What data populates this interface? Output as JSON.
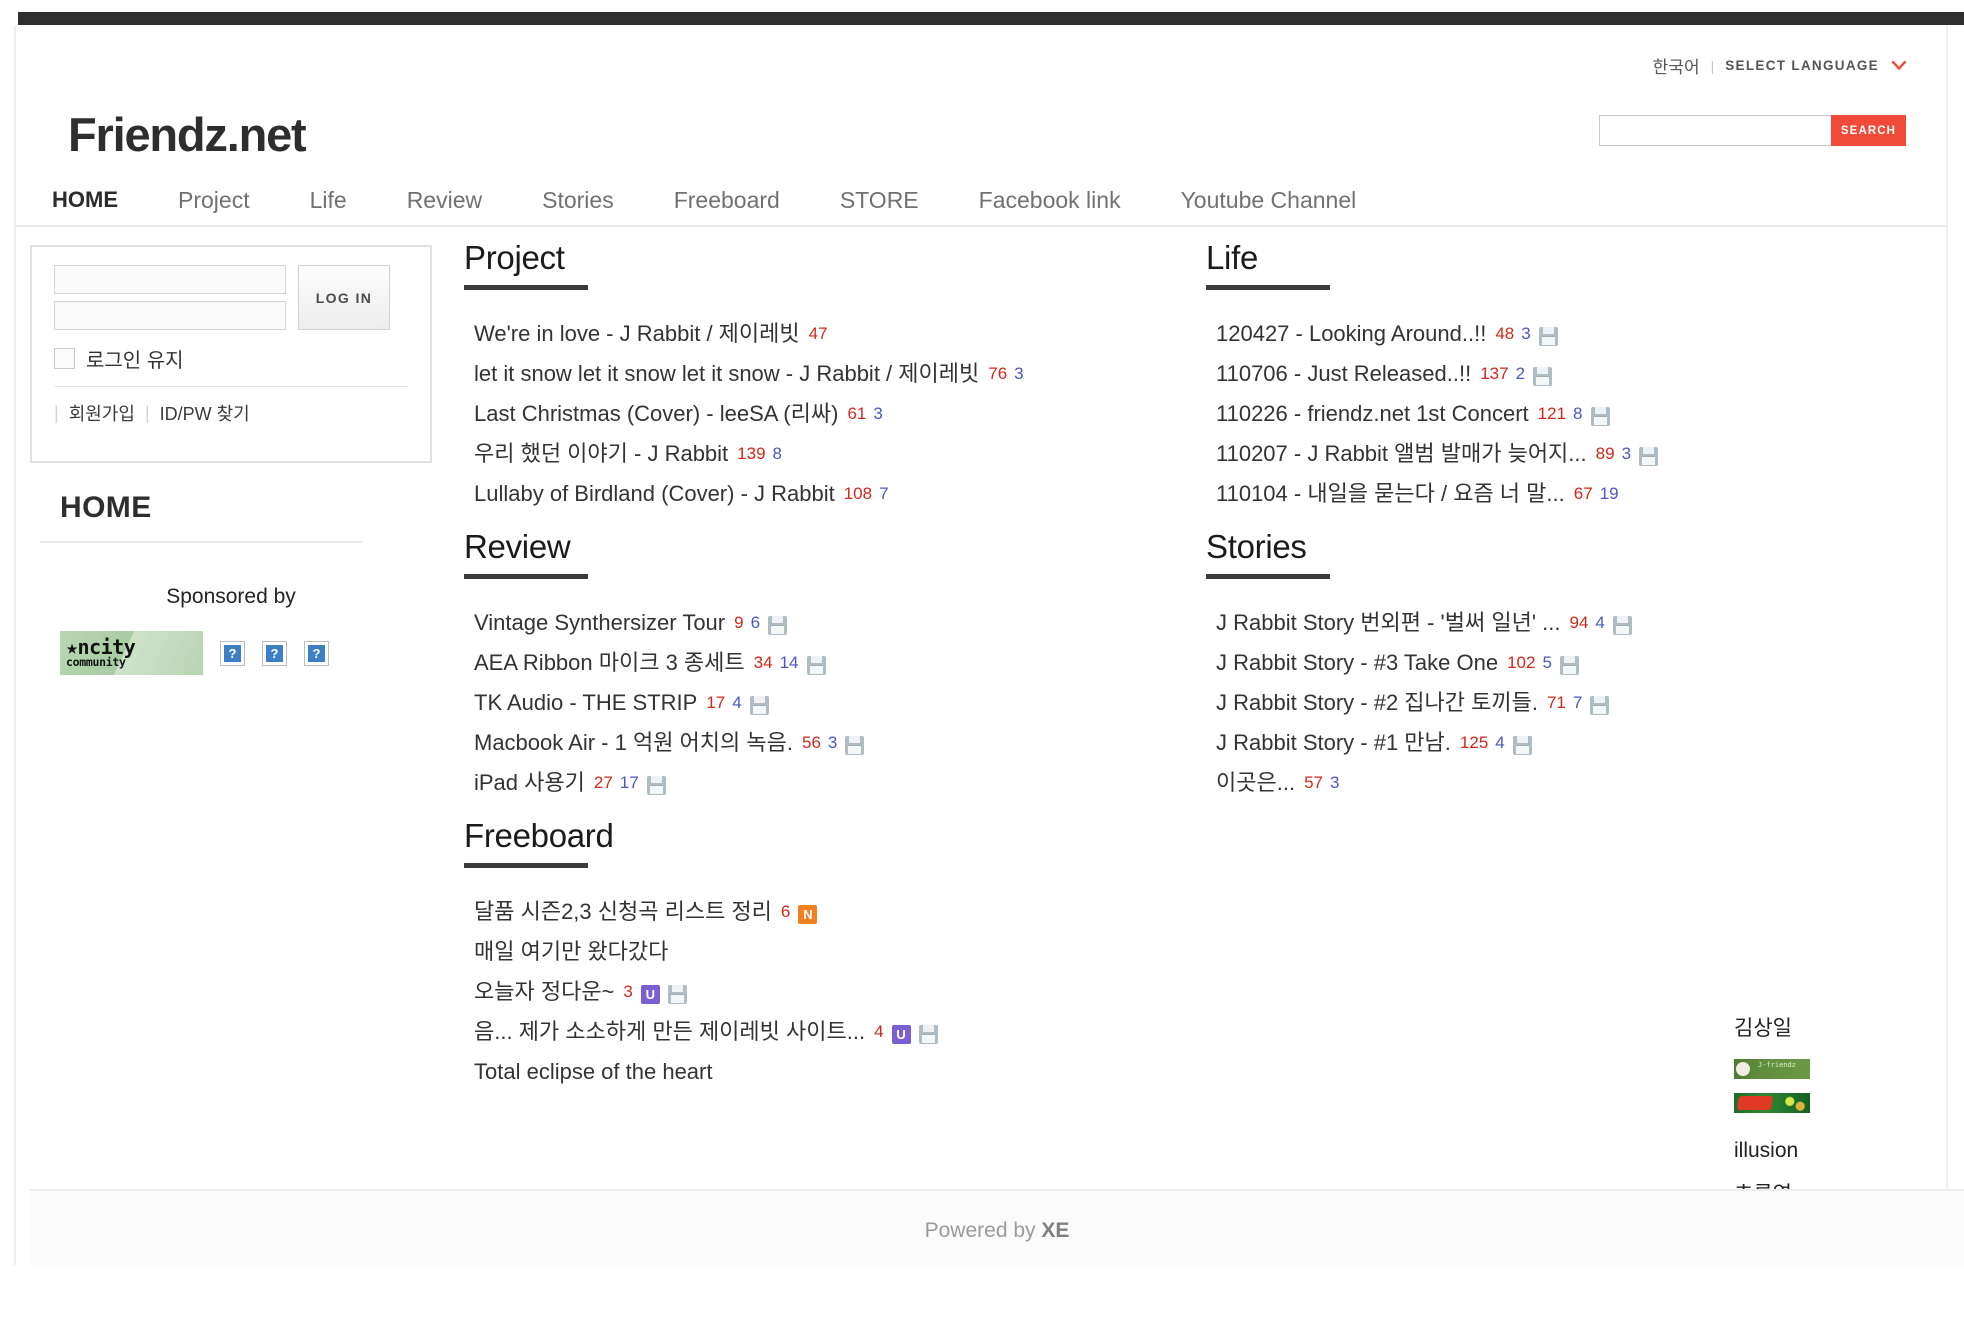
{
  "site": {
    "logo": "Friendz.net"
  },
  "topbar": {
    "current_language": "한국어",
    "separator": "|",
    "select_language": "SELECT LANGUAGE",
    "caret": "❯"
  },
  "search": {
    "value": "",
    "placeholder": "",
    "button": "SEARCH"
  },
  "nav": [
    {
      "label": "HOME",
      "active": true
    },
    {
      "label": "Project",
      "active": false
    },
    {
      "label": "Life",
      "active": false
    },
    {
      "label": "Review",
      "active": false
    },
    {
      "label": "Stories",
      "active": false
    },
    {
      "label": "Freeboard",
      "active": false
    },
    {
      "label": "STORE",
      "active": false
    },
    {
      "label": "Facebook link",
      "active": false
    },
    {
      "label": "Youtube Channel",
      "active": false
    }
  ],
  "login": {
    "id_value": "",
    "id_placeholder": "",
    "pw_value": "",
    "pw_placeholder": "",
    "button": "LOG IN",
    "keep_logged_in": "로그인 유지",
    "signup": "회원가입",
    "find_idpw": "ID/PW 찾기",
    "divider": "|"
  },
  "sidebar": {
    "title": "HOME",
    "sponsored_label": "Sponsored by",
    "ncity_line1": "★ncity",
    "ncity_line2": "community",
    "placeholders": [
      "?",
      "?",
      "?"
    ]
  },
  "sections": {
    "project": {
      "title": "Project",
      "items": [
        {
          "title": "We're in love - J Rabbit / 제이레빗",
          "views": "47",
          "comments": "",
          "icons": []
        },
        {
          "title": "let it snow let it snow let it snow - J Rabbit / 제이레빗",
          "views": "76",
          "comments": "3",
          "icons": []
        },
        {
          "title": "Last Christmas (Cover) - leeSA (리싸)",
          "views": "61",
          "comments": "3",
          "icons": []
        },
        {
          "title": "우리 했던 이야기 - J Rabbit",
          "views": "139",
          "comments": "8",
          "icons": []
        },
        {
          "title": "Lullaby of Birdland (Cover) - J Rabbit",
          "views": "108",
          "comments": "7",
          "icons": []
        }
      ]
    },
    "review": {
      "title": "Review",
      "items": [
        {
          "title": "Vintage Synthersizer Tour",
          "views": "9",
          "comments": "6",
          "icons": [
            "save-icon"
          ]
        },
        {
          "title": "AEA Ribbon 마이크 3 종세트",
          "views": "34",
          "comments": "14",
          "icons": [
            "save-icon"
          ]
        },
        {
          "title": "TK Audio - THE STRIP",
          "views": "17",
          "comments": "4",
          "icons": [
            "save-icon"
          ]
        },
        {
          "title": "Macbook Air - 1 억원 어치의 녹음.",
          "views": "56",
          "comments": "3",
          "icons": [
            "save-icon"
          ]
        },
        {
          "title": "iPad 사용기",
          "views": "27",
          "comments": "17",
          "icons": [
            "save-icon"
          ]
        }
      ]
    },
    "freeboard": {
      "title": "Freeboard",
      "items": [
        {
          "title": "달품 시즌2,3 신청곡 리스트 정리",
          "views": "6",
          "comments": "",
          "icons": [
            "naver-icon"
          ]
        },
        {
          "title": "매일 여기만 왔다갔다",
          "views": "",
          "comments": "",
          "icons": []
        },
        {
          "title": "오늘자 정다운~",
          "views": "3",
          "comments": "",
          "icons": [
            "u-icon",
            "save-icon"
          ]
        },
        {
          "title": "음... 제가 소소하게 만든 제이레빗 사이트...",
          "views": "4",
          "comments": "",
          "icons": [
            "u-icon",
            "save-icon"
          ]
        },
        {
          "title": "Total eclipse of the heart",
          "views": "",
          "comments": "",
          "icons": []
        }
      ]
    },
    "life": {
      "title": "Life",
      "items": [
        {
          "title": "120427 - Looking Around..!!",
          "views": "48",
          "comments": "3",
          "icons": [
            "save-icon"
          ]
        },
        {
          "title": "110706 - Just Released..!!",
          "views": "137",
          "comments": "2",
          "icons": [
            "save-icon"
          ]
        },
        {
          "title": "110226 - friendz.net 1st Concert",
          "views": "121",
          "comments": "8",
          "icons": [
            "save-icon"
          ]
        },
        {
          "title": "110207 - J Rabbit 앨범 발매가 늦어지...",
          "views": "89",
          "comments": "3",
          "icons": [
            "save-icon"
          ]
        },
        {
          "title": "110104 - 내일을 묻는다 / 요즘 너 말...",
          "views": "67",
          "comments": "19",
          "icons": []
        }
      ]
    },
    "stories": {
      "title": "Stories",
      "items": [
        {
          "title": "J Rabbit Story 번외편 - '벌써 일년' ...",
          "views": "94",
          "comments": "4",
          "icons": [
            "save-icon"
          ]
        },
        {
          "title": "J Rabbit Story - #3 Take One",
          "views": "102",
          "comments": "5",
          "icons": [
            "save-icon"
          ]
        },
        {
          "title": "J Rabbit Story - #2 집나간 토끼들.",
          "views": "71",
          "comments": "7",
          "icons": [
            "save-icon"
          ]
        },
        {
          "title": "J Rabbit Story - #1 만남.",
          "views": "125",
          "comments": "4",
          "icons": [
            "save-icon"
          ]
        },
        {
          "title": "이곳은...",
          "views": "57",
          "comments": "3",
          "icons": []
        }
      ]
    }
  },
  "misc_column": {
    "name1": "김상일",
    "banner1_alt": "J-friendz",
    "banner2_alt": "주례밥",
    "name2": "illusion",
    "name3": "초록연"
  },
  "footer": {
    "powered_prefix": "Powered by ",
    "powered_brand": "XE"
  },
  "colors": {
    "accent_red": "#ef4b38",
    "views_red": "#d0291c",
    "comments_blue": "#4b57c4",
    "topbar_dark": "#2e2e2e",
    "naver_orange": "#f08020",
    "u_purple": "#7a5fd3"
  }
}
